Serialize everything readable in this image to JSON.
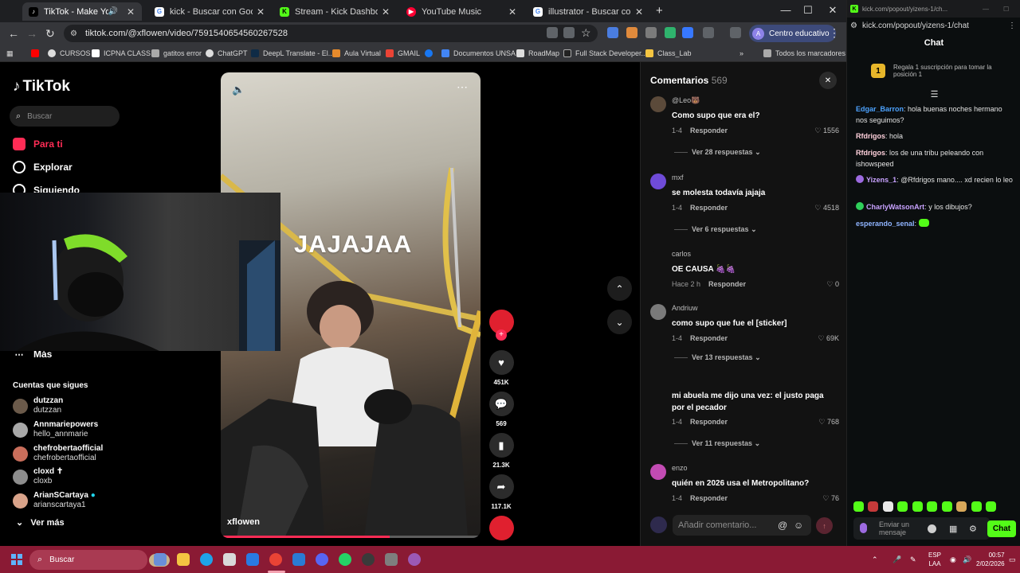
{
  "browser": {
    "tabs": [
      {
        "title": "TikTok - Make Your Day",
        "active": true
      },
      {
        "title": "kick - Buscar con Google"
      },
      {
        "title": "Stream - Kick Dashboard"
      },
      {
        "title": "YouTube Music"
      },
      {
        "title": "illustrator - Buscar con Google"
      }
    ],
    "url": "tiktok.com/@xflowen/video/7591540654560267528",
    "profile_label": "Centro educativo",
    "bookmarks": [
      "CURSOS",
      "ICPNA CLASS",
      "gatitos error",
      "ChatGPT",
      "DeepL Translate - El...",
      "Aula Virtual",
      "GMAIL",
      "Documentos UNSA",
      "RoadMap",
      "Full Stack Developer...",
      "Class_Lab"
    ],
    "all_bookmarks": "Todos los marcadores"
  },
  "tiktok": {
    "logo": "TikTok",
    "search_placeholder": "Buscar",
    "nav": {
      "for_you": "Para ti",
      "explore": "Explorar",
      "following": "Siguiendo",
      "more": "Más"
    },
    "following_title": "Cuentas que sigues",
    "following_accounts": [
      {
        "name": "dutzzan",
        "handle": "dutzzan"
      },
      {
        "name": "Annmariepowers",
        "handle": "hello_annmarie"
      },
      {
        "name": "chefrobertaofficial",
        "handle": "chefrobertaofficial"
      },
      {
        "name": "cloxd ✝",
        "handle": "cloxb"
      },
      {
        "name": "ArianSCartaya",
        "handle": "arianscartaya1"
      }
    ],
    "see_more": "Ver más",
    "video": {
      "overlay_text": "JAJAJAA",
      "author": "xflowen",
      "progress": 0.65
    },
    "actions": {
      "likes": "451K",
      "comments": "569",
      "saves": "21.3K",
      "shares": "117.1K"
    }
  },
  "comments": {
    "title": "Comentarios",
    "count": "569",
    "input_placeholder": "Añadir comentario...",
    "reply_label": "Responder",
    "items": [
      {
        "user": "@Leo🐻",
        "text": "Como supo que era el?",
        "date": "1-4",
        "likes": "1556",
        "replies": "Ver 28 respuestas"
      },
      {
        "user": "mxf",
        "text": "se molesta todavía jajaja",
        "date": "1-4",
        "likes": "4518",
        "replies": "Ver 6 respuestas"
      },
      {
        "user": "carlos",
        "text": "OE CAUSA 🍇🍇",
        "date": "Hace 2 h",
        "likes": "0",
        "replies": ""
      },
      {
        "user": "Andriuw",
        "text": "como supo que fue el [sticker]",
        "date": "1-4",
        "likes": "69K",
        "replies": "Ver 13 respuestas"
      },
      {
        "user": "",
        "text": "mi abuela me dijo una vez: el justo paga por el pecador",
        "date": "1-4",
        "likes": "768",
        "replies": "Ver 11 respuestas"
      },
      {
        "user": "enzo",
        "text": "quién en 2026 usa el Metropolitano?",
        "date": "1-4",
        "likes": "76",
        "replies": ""
      }
    ]
  },
  "kick": {
    "bar_url": "kick.com/popout/yizens-1/ch...",
    "url": "kick.com/popout/yizens-1/chat",
    "title": "Chat",
    "gift_badge": "1",
    "gift_text": "Regala 1 suscripción para tomar la posición 1",
    "messages": [
      {
        "user": "Edgar_Barron",
        "color": "#4da3ff",
        "text": "hola buenas noches hermano nos seguimos?"
      },
      {
        "user": "Rfdrigos",
        "color": "#ffd1dc",
        "text": "hola"
      },
      {
        "user": "Rfdrigos",
        "color": "#ffd1dc",
        "text": "los de una tribu peleando con ishowspeed"
      },
      {
        "user": "Yizens_1",
        "color": "#c8a2ff",
        "text": "@Rfdrigos mano.... xd recien lo leo"
      },
      {
        "user": "CharlyWatsonArt",
        "color": "#c8a2ff",
        "text": "y los dibujos?"
      },
      {
        "user": "esperando_senal",
        "color": "#8fb4ff",
        "text": ""
      }
    ],
    "input_placeholder": "Enviar un mensaje",
    "chat_button": "Chat"
  },
  "taskbar": {
    "search": "Buscar",
    "lang_line1": "ESP",
    "lang_line2": "LAA",
    "time": "00:57",
    "date": "2/02/2026"
  }
}
